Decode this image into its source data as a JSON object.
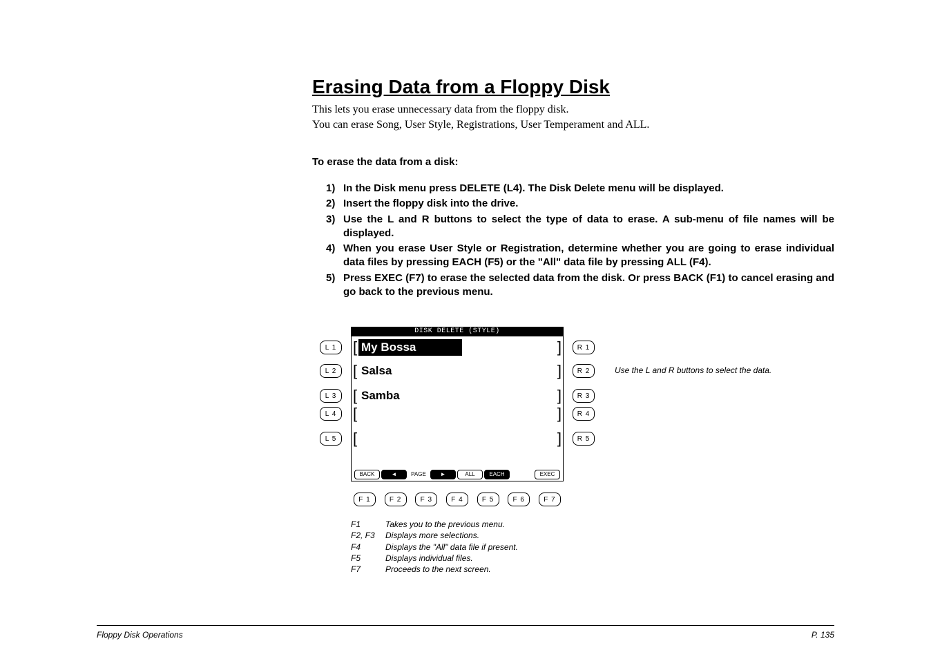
{
  "title": "Erasing Data from a Floppy Disk",
  "intro_line1": "This lets you erase unnecessary data from the floppy disk.",
  "intro_line2": "You can erase Song, User Style, Registrations, User Temperament and ALL.",
  "subheading": "To erase the data from a disk:",
  "steps": [
    {
      "num": "1)",
      "text": "In the Disk menu press DELETE (L4).  The Disk Delete menu will be displayed."
    },
    {
      "num": "2)",
      "text": "Insert the floppy disk into the drive."
    },
    {
      "num": "3)",
      "text": "Use the L and R buttons to select the type of data to erase.  A sub-menu of file names will be displayed."
    },
    {
      "num": "4)",
      "text": "When you erase User Style or Registration, determine whether you are going to erase individual data files by pressing EACH (F5) or the \"All\" data file by pressing ALL (F4)."
    },
    {
      "num": "5)",
      "text": "Press EXEC (F7) to erase the selected data from the disk.  Or press BACK (F1) to cancel erasing and go back to the previous menu."
    }
  ],
  "screen": {
    "header": "DISK DELETE (STYLE)",
    "items": [
      "My Bossa",
      "Salsa",
      "Samba",
      "",
      ""
    ],
    "l_buttons": [
      "L 1",
      "L 2",
      "L 3",
      "L 4",
      "L 5"
    ],
    "r_buttons": [
      "R 1",
      "R 2",
      "R 3",
      "R 4",
      "R 5"
    ],
    "soft_buttons": [
      {
        "label": "BACK",
        "sel": false
      },
      {
        "label": "◄",
        "sel": true
      },
      {
        "label": "PAGE",
        "sel": false,
        "plain": true
      },
      {
        "label": "►",
        "sel": true
      },
      {
        "label": "ALL",
        "sel": false
      },
      {
        "label": "EACH",
        "sel": true
      },
      {
        "label": "",
        "sel": false,
        "plain": true
      },
      {
        "label": "EXEC",
        "sel": false
      }
    ],
    "f_buttons": [
      "F 1",
      "F 2",
      "F 3",
      "F 4",
      "F 5",
      "F 6",
      "F 7"
    ]
  },
  "f_legend": [
    {
      "key": "F1",
      "desc": "Takes you to the previous menu."
    },
    {
      "key": "F2, F3",
      "desc": "Displays more selections."
    },
    {
      "key": "F4",
      "desc": "Displays the \"All\" data file if present."
    },
    {
      "key": "F5",
      "desc": "Displays individual files."
    },
    {
      "key": "F7",
      "desc": "Proceeds to the next screen."
    }
  ],
  "side_note": "Use the L and R buttons to select the data.",
  "footer": {
    "left": "Floppy Disk Operations",
    "right": "P. 135"
  }
}
